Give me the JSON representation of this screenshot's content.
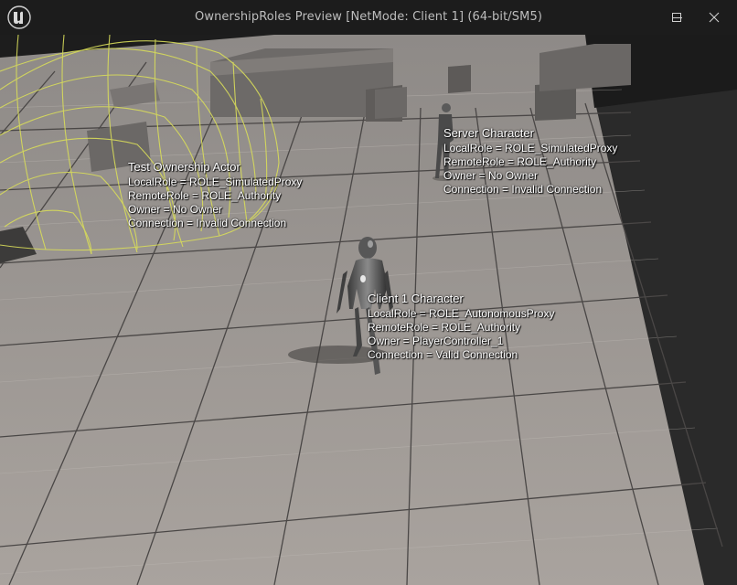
{
  "window": {
    "title": "OwnershipRoles Preview [NetMode: Client 1]  (64-bit/SM5)",
    "controls": [
      "minimize",
      "maximize",
      "close"
    ]
  },
  "actors": {
    "server": {
      "title": "Server Character",
      "lines": [
        "LocalRole = ROLE_SimulatedProxy",
        "RemoteRole = ROLE_Authority",
        "Owner = No Owner",
        "Connection = Invalid Connection"
      ]
    },
    "test": {
      "title": "Test Ownership Actor",
      "lines": [
        "LocalRole = ROLE_SimulatedProxy",
        "RemoteRole = ROLE_Authority",
        "Owner = No Owner",
        "Connection = Invalid Connection"
      ]
    },
    "client": {
      "title": "Client 1 Character",
      "lines": [
        "LocalRole = ROLE_AutonomousProxy",
        "RemoteRole = ROLE_Authority",
        "Owner = PlayerController_1",
        "Connection = Valid Connection"
      ]
    }
  },
  "colors": {
    "titlebar": "#1c1c1c",
    "floor": "#a29d98",
    "grid_major": "#4a4746",
    "wireframe": "#d8dc5a",
    "sky": "#1d1d1d",
    "label_text": "#ffffff"
  }
}
